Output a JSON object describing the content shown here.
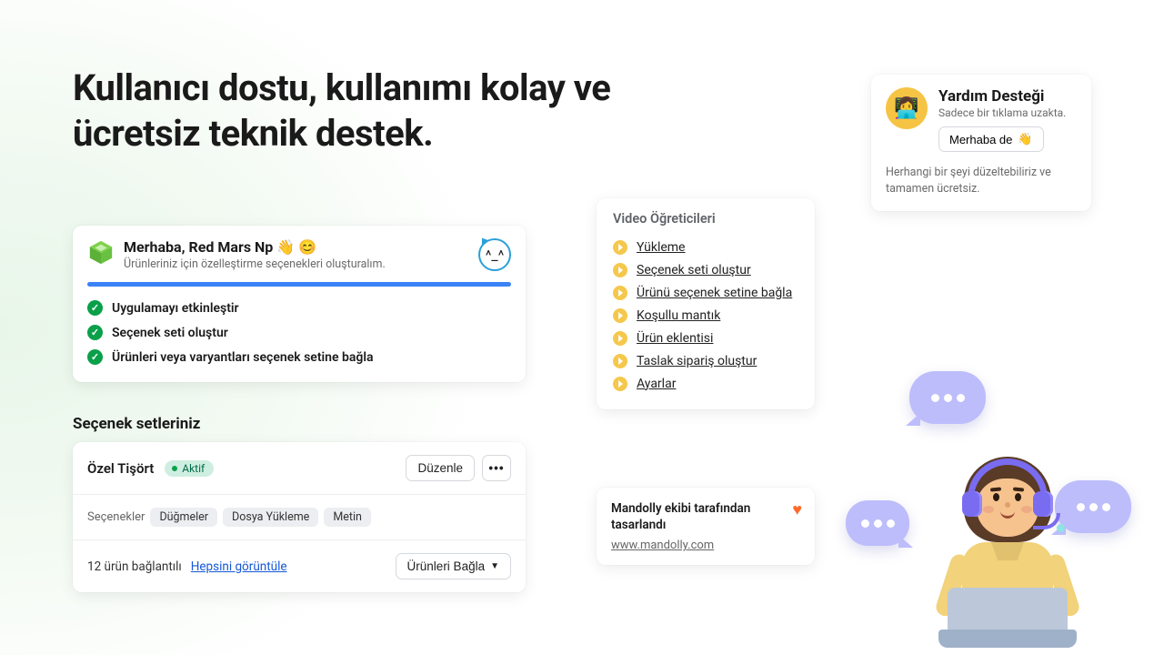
{
  "page_title": "Kullanıcı dostu, kullanımı kolay ve ücretsiz teknik destek.",
  "welcome": {
    "greeting": "Merhaba, Red Mars Np",
    "greeting_emoji": "👋 😊",
    "subtitle": "Ürünleriniz için özelleştirme seçenekleri oluşturalım.",
    "steps": [
      "Uygulamayı etkinleştir",
      "Seçenek seti oluştur",
      "Ürünleri veya varyantları seçenek setine bağla"
    ]
  },
  "option_sets": {
    "section_title": "Seçenek setleriniz",
    "item": {
      "name": "Özel Tişört",
      "status_label": "Aktif",
      "edit_label": "Düzenle",
      "options_label": "Seçenekler",
      "option_chips": [
        "Düğmeler",
        "Dosya Yükleme",
        "Metin"
      ],
      "linked_text": "12 ürün bağlantılı",
      "view_all_label": "Hepsini görüntüle",
      "link_products_label": "Ürünleri Bağla"
    }
  },
  "videos": {
    "title": "Video Öğreticileri",
    "items": [
      "Yükleme",
      "Seçenek seti oluştur",
      "Ürünü seçenek setine bağla",
      "Koşullu mantık",
      "Ürün eklentisi",
      "Taslak sipariş oluştur",
      "Ayarlar"
    ]
  },
  "credit": {
    "text": "Mandolly ekibi tarafından tasarlandı",
    "link": "www.mandolly.com",
    "heart": "♥"
  },
  "help": {
    "title": "Yardım Desteği",
    "subtitle": "Sadece bir tıklama uzakta.",
    "button_label": "Merhaba de",
    "button_emoji": "👋",
    "description": "Herhangi bir şeyi düzeltebiliriz ve tamamen ücretsiz.",
    "avatar_emoji": "👩‍💻"
  },
  "illustration": {
    "face_emoji": "^_^"
  }
}
